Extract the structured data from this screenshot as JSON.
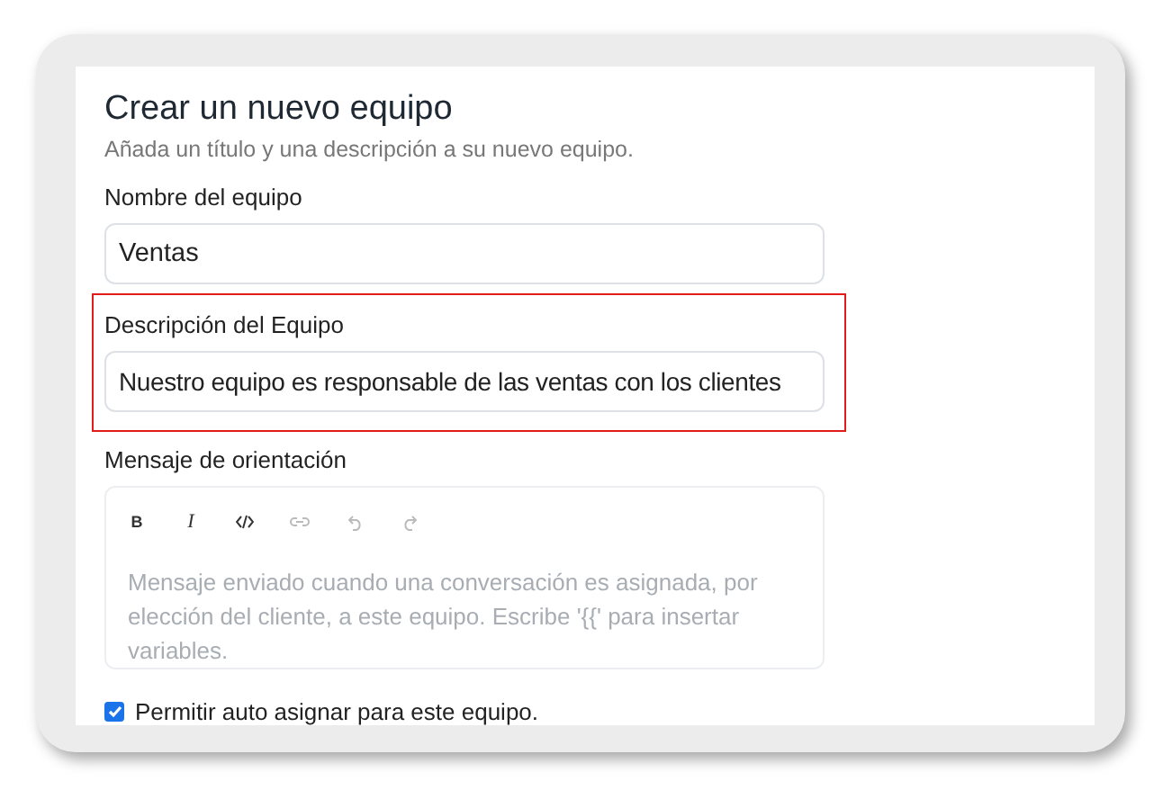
{
  "form": {
    "title": "Crear un nuevo equipo",
    "subtitle": "Añada un título y una descripción a su nuevo equipo.",
    "fields": [
      {
        "label": "Nombre del equipo",
        "value": "Ventas",
        "highlighted": false
      },
      {
        "label": "Descripción del Equipo",
        "value": "Nuestro equipo es responsable de las ventas con los clientes",
        "highlighted": true
      }
    ],
    "editor": {
      "label": "Mensaje de orientación",
      "placeholder": "Mensaje enviado cuando una conversación es asignada, por elección del cliente, a este equipo. Escribe '{{' para insertar variables.",
      "toolbar": [
        {
          "kind": "bold",
          "label": "B",
          "disabled": false
        },
        {
          "kind": "italic",
          "label": "I",
          "disabled": false
        },
        {
          "kind": "code",
          "disabled": false
        },
        {
          "kind": "link",
          "disabled": true
        },
        {
          "kind": "undo",
          "disabled": true
        },
        {
          "kind": "redo",
          "disabled": true
        }
      ]
    },
    "auto_assign": {
      "label": "Permitir auto asignar para este equipo.",
      "checked": true
    }
  }
}
